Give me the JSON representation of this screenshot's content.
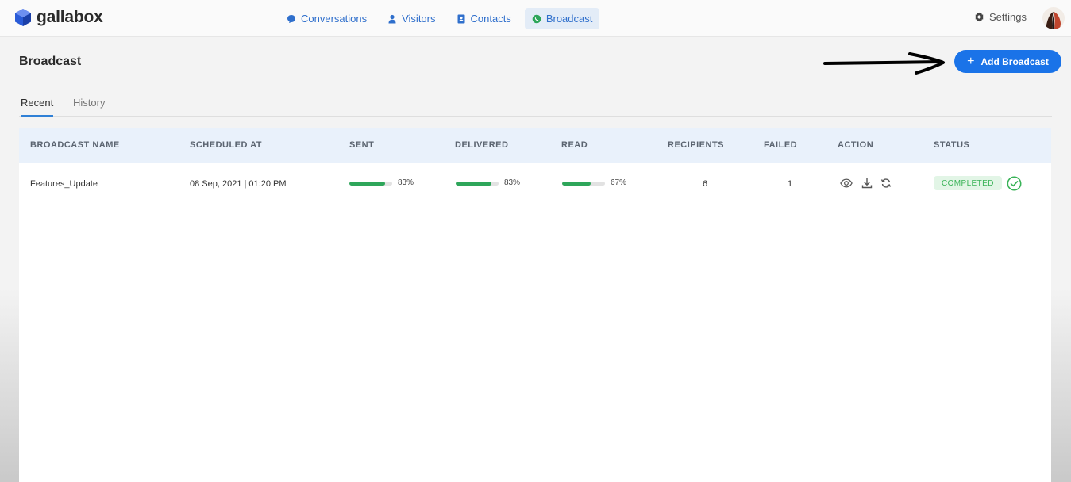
{
  "app": {
    "name": "gallabox"
  },
  "nav": {
    "items": [
      {
        "label": "Conversations",
        "icon": "chat-bubble-icon"
      },
      {
        "label": "Visitors",
        "icon": "person-icon"
      },
      {
        "label": "Contacts",
        "icon": "contact-card-icon"
      },
      {
        "label": "Broadcast",
        "icon": "whatsapp-icon",
        "active": true
      }
    ],
    "settings_label": "Settings"
  },
  "page": {
    "title": "Broadcast",
    "add_button_label": "Add Broadcast"
  },
  "tabs": [
    {
      "label": "Recent",
      "active": true
    },
    {
      "label": "History",
      "active": false
    }
  ],
  "table": {
    "columns": [
      "BROADCAST NAME",
      "SCHEDULED AT",
      "SENT",
      "DELIVERED",
      "READ",
      "RECIPIENTS",
      "FAILED",
      "ACTION",
      "STATUS"
    ],
    "rows": [
      {
        "name": "Features_Update",
        "scheduled_at": "08 Sep, 2021 | 01:20 PM",
        "sent_pct": "83%",
        "sent_value": 0.83,
        "delivered_pct": "83%",
        "delivered_value": 0.83,
        "read_pct": "67%",
        "read_value": 0.67,
        "recipients": "6",
        "failed": "1",
        "actions": [
          "eye-icon",
          "download-icon",
          "refresh-icon"
        ],
        "status": "COMPLETED"
      }
    ]
  },
  "colors": {
    "accent": "#1a73e8",
    "progress": "#2ea65a",
    "status_bg": "#e2f5e6",
    "status_text": "#39b357",
    "header_bg": "#e9f1fb"
  }
}
